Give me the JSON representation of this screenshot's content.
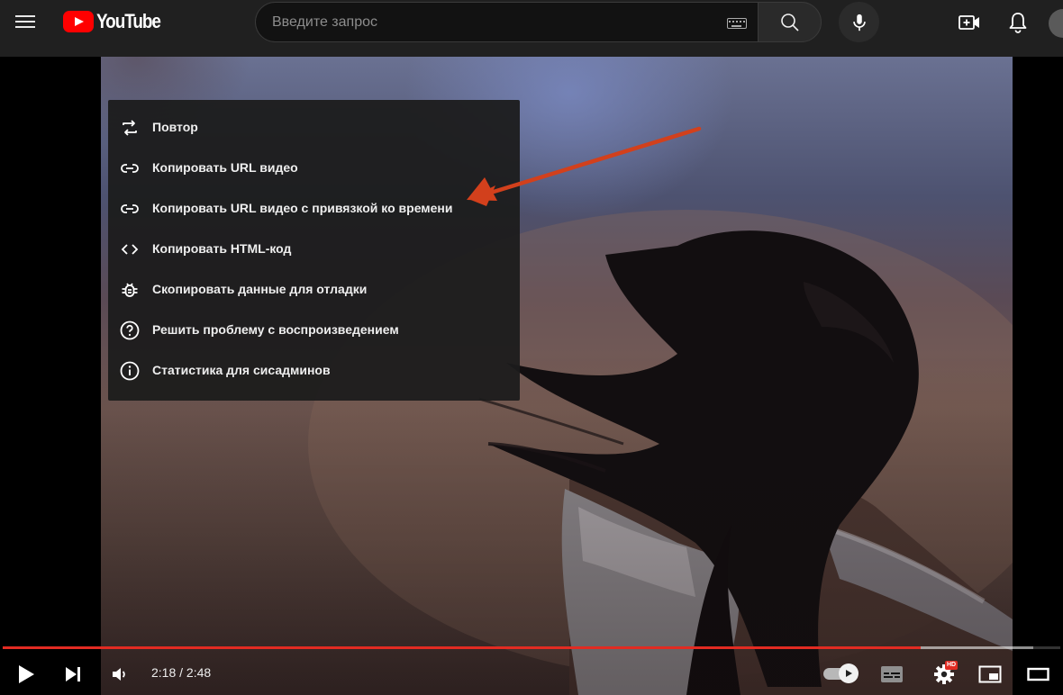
{
  "app": {
    "logo_text": "YouTube"
  },
  "search": {
    "placeholder": "Введите запрос"
  },
  "icons": {
    "menu": "hamburger-icon",
    "search": "search-icon",
    "keyboard": "keyboard-icon",
    "mic": "mic-icon",
    "create": "create-video-icon",
    "notifications": "bell-icon"
  },
  "context_menu": {
    "items": [
      {
        "icon": "repeat-icon",
        "label": "Повтор"
      },
      {
        "icon": "link-icon",
        "label": "Копировать URL видео"
      },
      {
        "icon": "link-icon",
        "label": "Копировать URL видео с привязкой ко времени"
      },
      {
        "icon": "code-icon",
        "label": "Копировать HTML-код"
      },
      {
        "icon": "bug-icon",
        "label": "Скопировать данные для отладки"
      },
      {
        "icon": "help-circle-icon",
        "label": "Решить проблему с воспроизведением"
      },
      {
        "icon": "info-icon",
        "label": "Статистика для сисадминов"
      }
    ]
  },
  "player": {
    "current_time": "2:18",
    "duration": "2:48",
    "time_display": "2:18 / 2:48",
    "progress_played": 0.8678,
    "progress_loaded": 0.9744,
    "hd_badge": "HD",
    "autoplay_on": true
  },
  "colors": {
    "accent": "#ff0000",
    "progress": "#e22b22",
    "arrow": "#d2401c",
    "masthead": "#202020"
  }
}
